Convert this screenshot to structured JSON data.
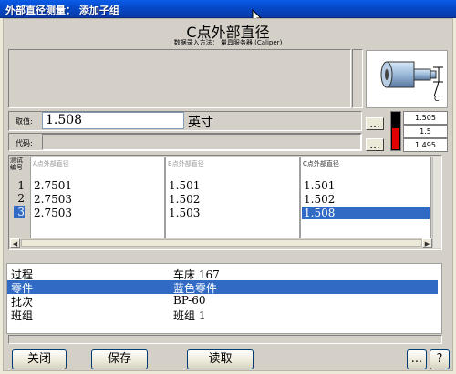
{
  "window": {
    "title": "外部直径测量： 添加子组"
  },
  "header": {
    "title": "C点外部直径",
    "subtitle": "数据录入方法： 量具服务器 (Caliper)"
  },
  "entry": {
    "value_label": "取值:",
    "value": "1.508",
    "unit": "英寸",
    "code_label": "代码:",
    "code_value": "",
    "more_button": "...",
    "code_more_button": "..."
  },
  "gauge": {
    "upper": "1.505",
    "target": "1.5",
    "lower": "1.495",
    "fill_fraction": 0.55,
    "bar_color": "#e00000"
  },
  "diagram": {
    "marker_label": "C"
  },
  "grid": {
    "row_header": "测试\n编号",
    "columns": [
      {
        "header": "A点外部直径",
        "values": [
          "2.7501",
          "2.7503",
          "2.7503"
        ]
      },
      {
        "header": "B点外部直径",
        "values": [
          "1.501",
          "1.502",
          "1.503"
        ]
      },
      {
        "header": "C点外部直径",
        "values": [
          "1.501",
          "1.502",
          "1.508"
        ]
      }
    ],
    "row_numbers": [
      "1",
      "2",
      "3"
    ],
    "selected_row": 3
  },
  "properties": [
    {
      "key": "过程",
      "value": "车床 167"
    },
    {
      "key": "零件",
      "value": "蓝色零件"
    },
    {
      "key": "批次",
      "value": "BP-60"
    },
    {
      "key": "班组",
      "value": "班组 1"
    }
  ],
  "selected_property": 1,
  "buttons": {
    "close": "关闭",
    "save": "保存",
    "read": "读取",
    "more": "...",
    "help": "?"
  }
}
